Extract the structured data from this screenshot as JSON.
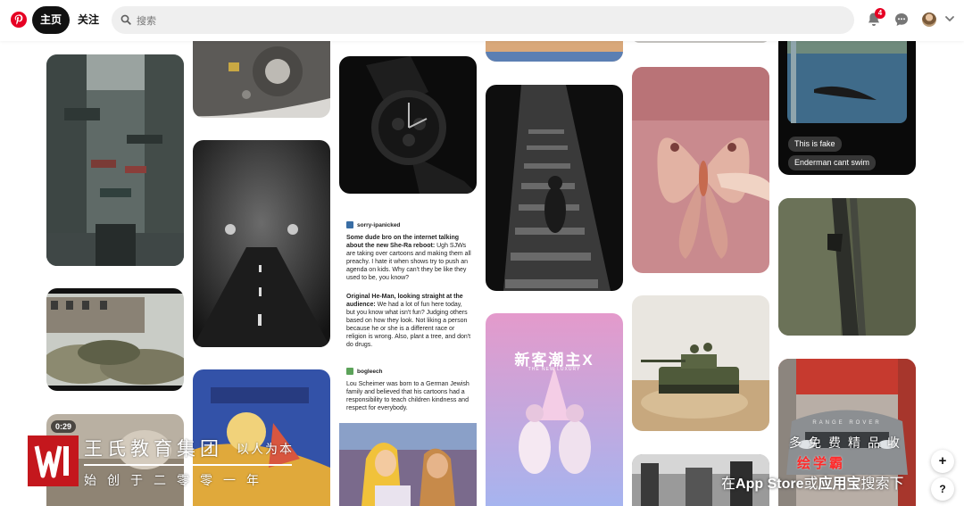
{
  "header": {
    "nav_home": "主页",
    "nav_follow": "关注",
    "search_placeholder": "搜索",
    "notification_count": "4"
  },
  "pins": {
    "video_duration": "0:29",
    "comment_1": "This is fake",
    "comment_2": "Enderman cant swim",
    "poster_title": "新客潮主X",
    "poster_subtitle": "THE NEW LUXURY",
    "car_brand": "RANGE ROVER"
  },
  "tumblr_post": {
    "user1": "sorry-ipanicked",
    "post1_title": "Some dude bro on the internet talking about the new She-Ra reboot:",
    "post1_body": "Ugh SJWs are taking over cartoons and making them all preachy. I hate it when shows try to push an agenda on kids. Why can't they be like they used to be, you know?",
    "post2_title": "Original He-Man, looking straight at the audience:",
    "post2_body": "We had a lot of fun here today, but you know what isn't fun? Judging others based on how they look. Not liking a person because he or she is a different race or religion is wrong. Also, plant a tree, and don't do drugs.",
    "user2": "bogleech",
    "post3_body": "Lou Scheimer was born to a German Jewish family and believed that his cartoons had a responsibility to teach children kindness and respect for everybody."
  },
  "watermark_left": {
    "title": "王氏教育集团",
    "motto": "以人为本",
    "subtitle": "始创于二零零一年"
  },
  "watermark_right": {
    "top": "多免费精品收",
    "brand": "绘学霸",
    "line_prefix": "在",
    "line_app": "App Store",
    "line_or": "或",
    "line_store2": "应用宝",
    "line_suffix": "搜索下"
  },
  "fab": {
    "add": "+",
    "help": "?"
  },
  "colors": {
    "brand_red": "#e60023",
    "watermark_red": "#c4171d"
  }
}
